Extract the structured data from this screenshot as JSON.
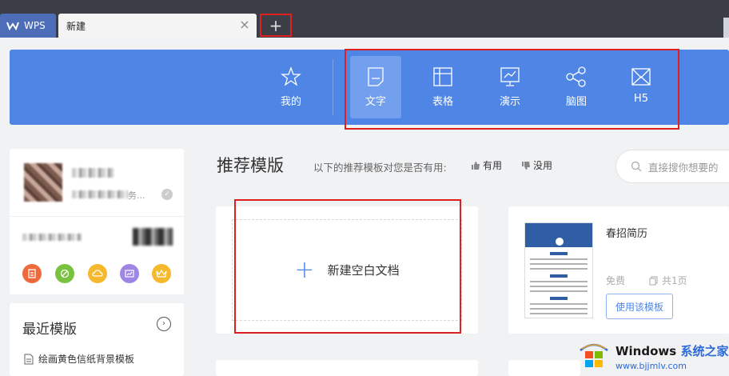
{
  "tabs": {
    "app_tab": "WPS",
    "doc_tab": "新建",
    "add_tab": "+"
  },
  "categories": [
    {
      "label": "我的",
      "icon": "star-icon",
      "active": false
    },
    {
      "label": "文字",
      "icon": "document-icon",
      "active": true
    },
    {
      "label": "表格",
      "icon": "table-icon",
      "active": false
    },
    {
      "label": "演示",
      "icon": "presentation-icon",
      "active": false
    },
    {
      "label": "脑图",
      "icon": "mindmap-icon",
      "active": false
    },
    {
      "label": "H5",
      "icon": "h5-icon",
      "active": false
    }
  ],
  "recommend": {
    "title": "推荐模版",
    "question": "以下的推荐模板对您是否有用:",
    "useful": "有用",
    "useless": "没用"
  },
  "search": {
    "placeholder": "直接搜你想要的"
  },
  "user": {
    "status_partial": "务..."
  },
  "recent": {
    "title": "最近模版",
    "items": [
      "绘画黄色信纸背景模板"
    ]
  },
  "blank_doc": {
    "label": "新建空白文档"
  },
  "template": {
    "name": "春招简历",
    "price": "免费",
    "pages": "共1页",
    "use_button": "使用该模板"
  },
  "watermark": {
    "brand": "Windows",
    "brand_cn": "系统之家",
    "url": "www.bjjmlv.com"
  },
  "colors": {
    "accent": "#4f86e6",
    "highlight_box": "#e02020",
    "tabbar": "#3b3e47"
  }
}
